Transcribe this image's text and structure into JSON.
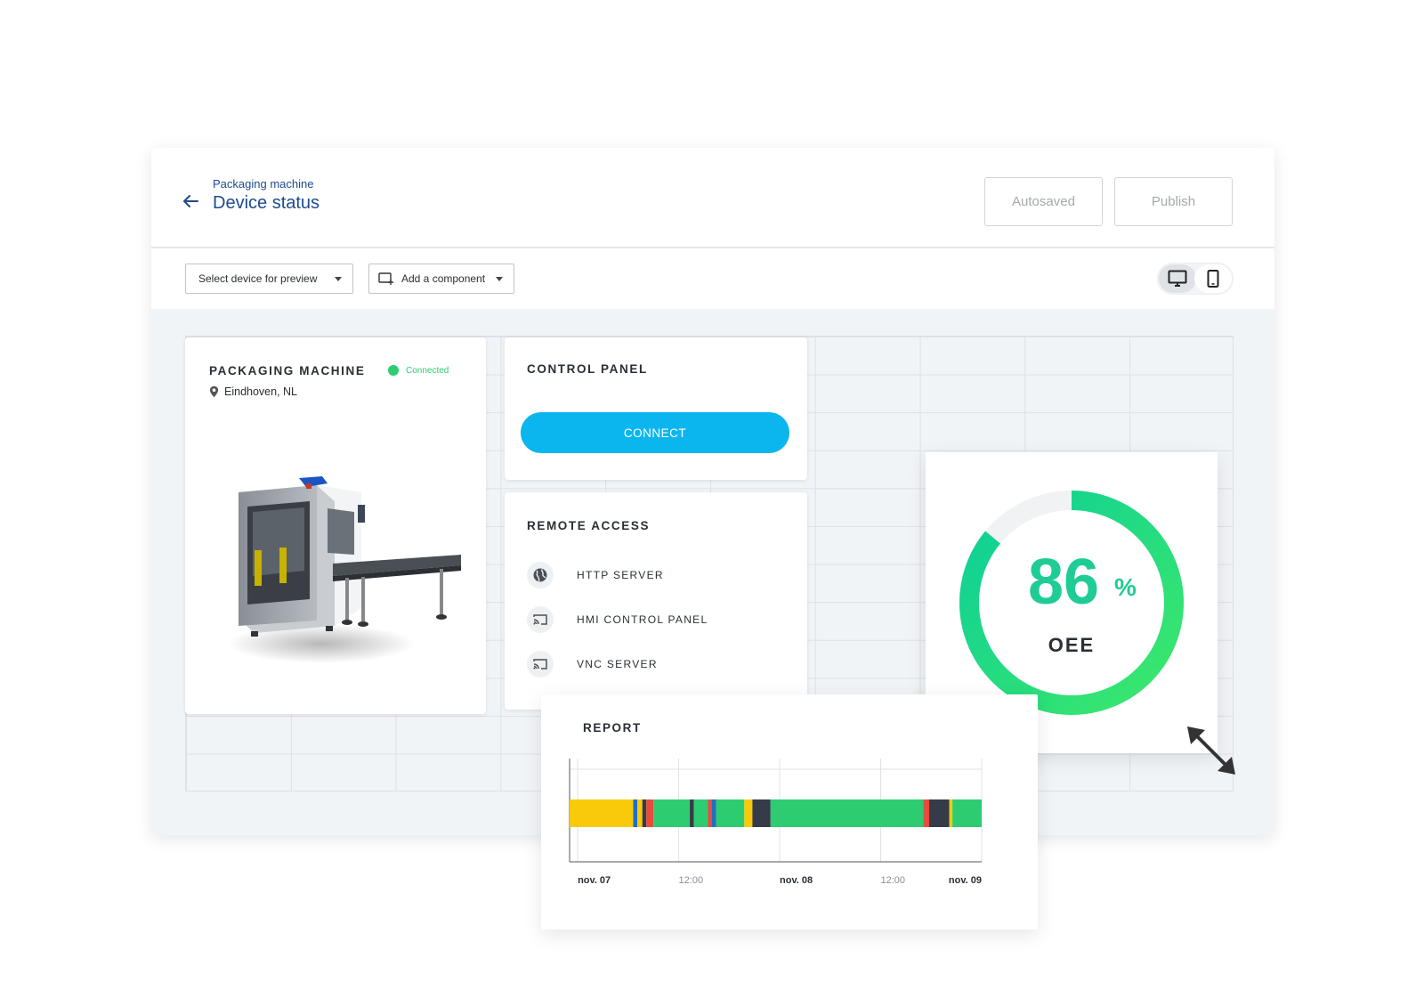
{
  "header": {
    "breadcrumb": "Packaging machine",
    "title": "Device status",
    "autosaved_label": "Autosaved",
    "publish_label": "Publish"
  },
  "toolbar": {
    "device_select_label": "Select device for preview",
    "add_component_label": "Add a component",
    "view_modes": [
      "desktop-icon",
      "mobile-icon"
    ]
  },
  "machine_card": {
    "title": "PACKAGING MACHINE",
    "status": "Connected",
    "location": "Eindhoven, NL"
  },
  "control_panel": {
    "title": "CONTROL PANEL",
    "connect_label": "CONNECT"
  },
  "remote_access": {
    "title": "REMOTE ACCESS",
    "items": [
      {
        "label": "HTTP SERVER",
        "icon": "globe-icon"
      },
      {
        "label": "HMI CONTROL PANEL",
        "icon": "cast-icon"
      },
      {
        "label": "VNC SERVER",
        "icon": "cast-icon"
      }
    ]
  },
  "oee": {
    "value": "86",
    "unit": "%",
    "label": "OEE",
    "fraction": 0.86
  },
  "report": {
    "title": "REPORT"
  },
  "chart_data": {
    "type": "bar",
    "orientation": "horizontal-timeline",
    "title": "REPORT",
    "x_ticks": [
      {
        "label": "nov. 07",
        "t": 0,
        "bold": true
      },
      {
        "label": "12:00",
        "t": 0.5,
        "bold": false
      },
      {
        "label": "nov. 08",
        "t": 1,
        "bold": true
      },
      {
        "label": "12:00",
        "t": 1.5,
        "bold": false
      },
      {
        "label": "nov. 09",
        "t": 2,
        "bold": true
      }
    ],
    "xlim": [
      -0.04,
      2
    ],
    "colors": {
      "yellow": "#f9ca0a",
      "blue": "#1f6fc4",
      "dark": "#353b48",
      "red": "#e74c3c",
      "green": "#2ecc71"
    },
    "segments": [
      {
        "start": -0.04,
        "end": 0.275,
        "state": "yellow"
      },
      {
        "start": 0.275,
        "end": 0.295,
        "state": "blue"
      },
      {
        "start": 0.295,
        "end": 0.32,
        "state": "yellow"
      },
      {
        "start": 0.32,
        "end": 0.34,
        "state": "dark"
      },
      {
        "start": 0.34,
        "end": 0.375,
        "state": "red"
      },
      {
        "start": 0.375,
        "end": 0.555,
        "state": "green"
      },
      {
        "start": 0.555,
        "end": 0.575,
        "state": "dark"
      },
      {
        "start": 0.575,
        "end": 0.645,
        "state": "green"
      },
      {
        "start": 0.645,
        "end": 0.665,
        "state": "red"
      },
      {
        "start": 0.665,
        "end": 0.685,
        "state": "blue"
      },
      {
        "start": 0.685,
        "end": 0.825,
        "state": "green"
      },
      {
        "start": 0.825,
        "end": 0.865,
        "state": "yellow"
      },
      {
        "start": 0.865,
        "end": 0.955,
        "state": "dark"
      },
      {
        "start": 0.955,
        "end": 1.71,
        "state": "green"
      },
      {
        "start": 1.71,
        "end": 1.74,
        "state": "red"
      },
      {
        "start": 1.74,
        "end": 1.84,
        "state": "dark"
      },
      {
        "start": 1.84,
        "end": 1.855,
        "state": "yellow"
      },
      {
        "start": 1.855,
        "end": 2.0,
        "state": "green"
      }
    ]
  }
}
